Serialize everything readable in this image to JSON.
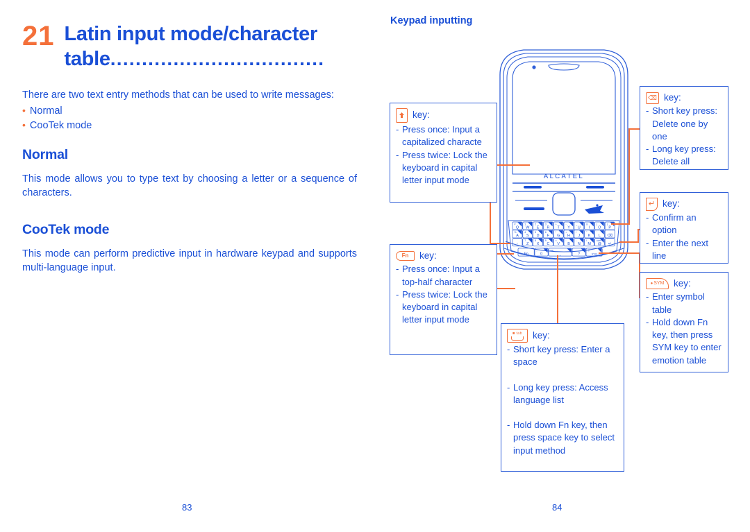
{
  "left_page": {
    "chapter_number": "21",
    "chapter_title": "Latin input mode/character table",
    "title_dots": "..................................",
    "intro": "There are two text entry methods that can be used to write messages:",
    "bullets": [
      {
        "marker": "•",
        "label": "Normal"
      },
      {
        "marker": "•",
        "label": "CooTek mode"
      }
    ],
    "sections": [
      {
        "heading": "Normal",
        "body": "This mode allows you to type text by choosing a letter or a sequence of characters."
      },
      {
        "heading": "CooTek mode",
        "body": "This mode can perform predictive input in hardware keypad and supports multi-language input."
      }
    ],
    "page_number": "83"
  },
  "right_page": {
    "heading": "Keypad inputting",
    "page_number": "84",
    "phone": {
      "brand_label": "ALCATEL",
      "keyboard_rows": [
        {
          "keys": [
            {
              "main": "Q",
              "alt": "#"
            },
            {
              "main": "W",
              "alt": "1"
            },
            {
              "main": "E",
              "alt": "2"
            },
            {
              "main": "R",
              "alt": "3"
            },
            {
              "main": "T",
              "alt": "+"
            },
            {
              "main": "Y",
              "alt": "-"
            },
            {
              "main": "U",
              "alt": "_"
            },
            {
              "main": "I",
              "alt": "&"
            },
            {
              "main": "O",
              "alt": "("
            },
            {
              "main": "P",
              "alt": ")"
            }
          ]
        },
        {
          "keys": [
            {
              "main": "A",
              "alt": "%"
            },
            {
              "main": "S",
              "alt": "4"
            },
            {
              "main": "D",
              "alt": "5"
            },
            {
              "main": "F",
              "alt": "6"
            },
            {
              "main": "G",
              "alt": "*"
            },
            {
              "main": "H",
              "alt": "="
            },
            {
              "main": "J",
              "alt": "/"
            },
            {
              "main": "K",
              "alt": "\""
            },
            {
              "main": "L",
              "alt": "'"
            },
            {
              "main": "⌫",
              "alt": ""
            }
          ]
        },
        {
          "keys": [
            {
              "main": "↑",
              "alt": ""
            },
            {
              "main": "Z",
              "alt": "7"
            },
            {
              "main": "X",
              "alt": "8"
            },
            {
              "main": "C",
              "alt": "9"
            },
            {
              "main": "V",
              "alt": "×"
            },
            {
              "main": "B",
              "alt": ":"
            },
            {
              "main": "N",
              "alt": ";"
            },
            {
              "main": "M",
              "alt": "!"
            },
            {
              "main": "@",
              "alt": "com"
            },
            {
              "main": "↵",
              "alt": ""
            }
          ]
        },
        {
          "keys": [
            {
              "main": "Fn",
              "alt": ""
            },
            {
              "main": "0",
              "alt": "."
            },
            {
              "main": "space",
              "alt": "tab"
            },
            {
              "main": "?",
              "alt": ","
            },
            {
              "main": "SYM",
              "alt": "©"
            }
          ]
        }
      ]
    },
    "callouts": [
      {
        "id": "shift-key",
        "icon": "shift-key-icon",
        "key_label": "key:",
        "lines": [
          {
            "dash": "-",
            "text": "Press once: Input a capitalized characte"
          },
          {
            "dash": "-",
            "text": "Press twice: Lock the keyboard in capital letter input mode"
          }
        ]
      },
      {
        "id": "fn-key",
        "icon": "fn-key-icon",
        "key_label": "key:",
        "lines": [
          {
            "dash": "-",
            "text": "Press once: Input a top-half character"
          },
          {
            "dash": "-",
            "text": "Press twice: Lock the keyboard in capital letter input mode"
          }
        ]
      },
      {
        "id": "space-key",
        "icon": "space-key-icon",
        "key_label": "key:",
        "lines": [
          {
            "dash": "-",
            "text": "Short key press: Enter a space"
          },
          {
            "dash": "",
            "text": ""
          },
          {
            "dash": "-",
            "text": "Long key press: Access language list"
          },
          {
            "dash": "",
            "text": ""
          },
          {
            "dash": "-",
            "text": "Hold down Fn key, then press space key to select input method"
          }
        ]
      },
      {
        "id": "delete-key",
        "icon": "delete-key-icon",
        "key_label": "key:",
        "lines": [
          {
            "dash": "-",
            "text": "Short key press: Delete one by one"
          },
          {
            "dash": "-",
            "text": "Long key press: Delete all"
          }
        ]
      },
      {
        "id": "enter-key",
        "icon": "enter-key-icon",
        "key_label": "key:",
        "lines": [
          {
            "dash": "-",
            "text": "Confirm an option"
          },
          {
            "dash": "-",
            "text": "Enter the next line"
          }
        ]
      },
      {
        "id": "sym-key",
        "icon": "sym-key-icon",
        "key_label": "key:",
        "lines": [
          {
            "dash": "-",
            "text": "Enter symbol table"
          },
          {
            "dash": "-",
            "text": "Hold down Fn key, then press SYM key to enter emotion table"
          }
        ]
      }
    ]
  },
  "colors": {
    "blue": "#1a4fd6",
    "orange": "#f4703a",
    "box_border": "#2f5fd8"
  }
}
